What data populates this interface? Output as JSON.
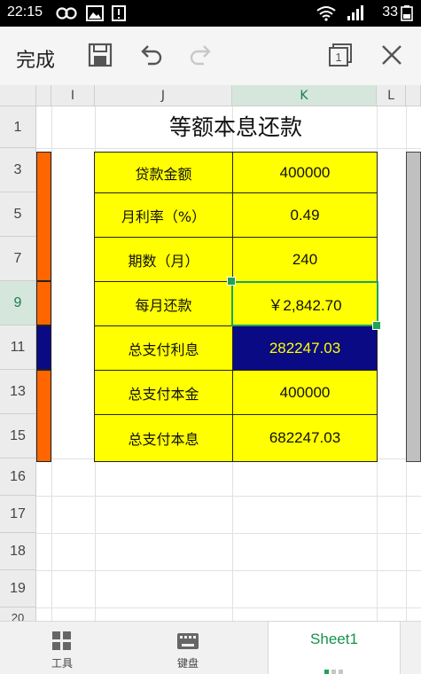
{
  "status": {
    "time": "22:15",
    "battery": "33"
  },
  "toolbar": {
    "done_label": "完成",
    "icons": [
      "save-icon",
      "undo-icon",
      "redo-icon",
      "window-count-icon",
      "close-icon"
    ],
    "window_count": "1"
  },
  "columns": [
    "I",
    "J",
    "K",
    "L"
  ],
  "rows": [
    "1",
    "3",
    "5",
    "7",
    "9",
    "11",
    "13",
    "15",
    "16",
    "17",
    "18",
    "19",
    "20"
  ],
  "sheet_title": "等额本息还款",
  "table": [
    {
      "label": "贷款金额",
      "value": "400000"
    },
    {
      "label": "月利率（%）",
      "value": "0.49"
    },
    {
      "label": "期数（月）",
      "value": "240"
    },
    {
      "label": "每月还款",
      "value": "￥2,842.70"
    },
    {
      "label": "总支付利息",
      "value": "282247.03"
    },
    {
      "label": "总支付本金",
      "value": "400000"
    },
    {
      "label": "总支付本息",
      "value": "682247.03"
    }
  ],
  "colors": {
    "cell_fill": "#ffff00",
    "highlight_fill": "#0a0a84",
    "highlight_text": "#ffff00",
    "accent_green": "#1fa35a",
    "left_bar_orange": "#ff6600",
    "left_bar_navy": "#0a0a84",
    "right_bar_gray": "#c0c0c0"
  },
  "bottom": {
    "tools_label": "工具",
    "keyboard_label": "键盘",
    "sheet_name": "Sheet1"
  }
}
